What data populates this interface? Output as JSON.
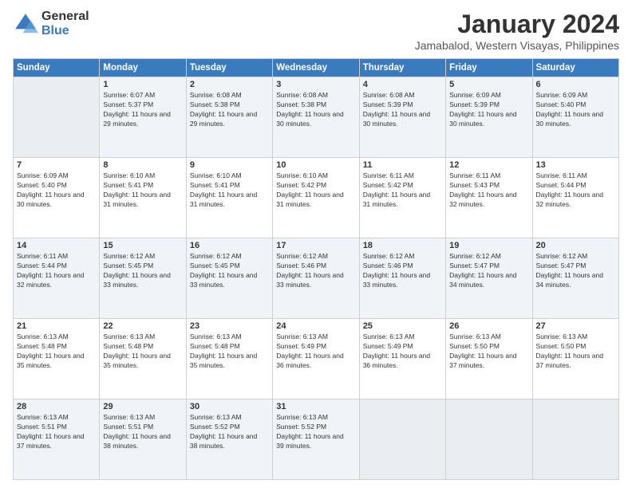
{
  "logo": {
    "general": "General",
    "blue": "Blue"
  },
  "header": {
    "month": "January 2024",
    "location": "Jamabalod, Western Visayas, Philippines"
  },
  "weekdays": [
    "Sunday",
    "Monday",
    "Tuesday",
    "Wednesday",
    "Thursday",
    "Friday",
    "Saturday"
  ],
  "weeks": [
    [
      {
        "day": "",
        "empty": true
      },
      {
        "day": "1",
        "sunrise": "6:07 AM",
        "sunset": "5:37 PM",
        "daylight": "11 hours and 29 minutes."
      },
      {
        "day": "2",
        "sunrise": "6:08 AM",
        "sunset": "5:38 PM",
        "daylight": "11 hours and 29 minutes."
      },
      {
        "day": "3",
        "sunrise": "6:08 AM",
        "sunset": "5:38 PM",
        "daylight": "11 hours and 30 minutes."
      },
      {
        "day": "4",
        "sunrise": "6:08 AM",
        "sunset": "5:39 PM",
        "daylight": "11 hours and 30 minutes."
      },
      {
        "day": "5",
        "sunrise": "6:09 AM",
        "sunset": "5:39 PM",
        "daylight": "11 hours and 30 minutes."
      },
      {
        "day": "6",
        "sunrise": "6:09 AM",
        "sunset": "5:40 PM",
        "daylight": "11 hours and 30 minutes."
      }
    ],
    [
      {
        "day": "7",
        "sunrise": "6:09 AM",
        "sunset": "5:40 PM",
        "daylight": "11 hours and 30 minutes."
      },
      {
        "day": "8",
        "sunrise": "6:10 AM",
        "sunset": "5:41 PM",
        "daylight": "11 hours and 31 minutes."
      },
      {
        "day": "9",
        "sunrise": "6:10 AM",
        "sunset": "5:41 PM",
        "daylight": "11 hours and 31 minutes."
      },
      {
        "day": "10",
        "sunrise": "6:10 AM",
        "sunset": "5:42 PM",
        "daylight": "11 hours and 31 minutes."
      },
      {
        "day": "11",
        "sunrise": "6:11 AM",
        "sunset": "5:42 PM",
        "daylight": "11 hours and 31 minutes."
      },
      {
        "day": "12",
        "sunrise": "6:11 AM",
        "sunset": "5:43 PM",
        "daylight": "11 hours and 32 minutes."
      },
      {
        "day": "13",
        "sunrise": "6:11 AM",
        "sunset": "5:44 PM",
        "daylight": "11 hours and 32 minutes."
      }
    ],
    [
      {
        "day": "14",
        "sunrise": "6:11 AM",
        "sunset": "5:44 PM",
        "daylight": "11 hours and 32 minutes."
      },
      {
        "day": "15",
        "sunrise": "6:12 AM",
        "sunset": "5:45 PM",
        "daylight": "11 hours and 33 minutes."
      },
      {
        "day": "16",
        "sunrise": "6:12 AM",
        "sunset": "5:45 PM",
        "daylight": "11 hours and 33 minutes."
      },
      {
        "day": "17",
        "sunrise": "6:12 AM",
        "sunset": "5:46 PM",
        "daylight": "11 hours and 33 minutes."
      },
      {
        "day": "18",
        "sunrise": "6:12 AM",
        "sunset": "5:46 PM",
        "daylight": "11 hours and 33 minutes."
      },
      {
        "day": "19",
        "sunrise": "6:12 AM",
        "sunset": "5:47 PM",
        "daylight": "11 hours and 34 minutes."
      },
      {
        "day": "20",
        "sunrise": "6:12 AM",
        "sunset": "5:47 PM",
        "daylight": "11 hours and 34 minutes."
      }
    ],
    [
      {
        "day": "21",
        "sunrise": "6:13 AM",
        "sunset": "5:48 PM",
        "daylight": "11 hours and 35 minutes."
      },
      {
        "day": "22",
        "sunrise": "6:13 AM",
        "sunset": "5:48 PM",
        "daylight": "11 hours and 35 minutes."
      },
      {
        "day": "23",
        "sunrise": "6:13 AM",
        "sunset": "5:48 PM",
        "daylight": "11 hours and 35 minutes."
      },
      {
        "day": "24",
        "sunrise": "6:13 AM",
        "sunset": "5:49 PM",
        "daylight": "11 hours and 36 minutes."
      },
      {
        "day": "25",
        "sunrise": "6:13 AM",
        "sunset": "5:49 PM",
        "daylight": "11 hours and 36 minutes."
      },
      {
        "day": "26",
        "sunrise": "6:13 AM",
        "sunset": "5:50 PM",
        "daylight": "11 hours and 37 minutes."
      },
      {
        "day": "27",
        "sunrise": "6:13 AM",
        "sunset": "5:50 PM",
        "daylight": "11 hours and 37 minutes."
      }
    ],
    [
      {
        "day": "28",
        "sunrise": "6:13 AM",
        "sunset": "5:51 PM",
        "daylight": "11 hours and 37 minutes."
      },
      {
        "day": "29",
        "sunrise": "6:13 AM",
        "sunset": "5:51 PM",
        "daylight": "11 hours and 38 minutes."
      },
      {
        "day": "30",
        "sunrise": "6:13 AM",
        "sunset": "5:52 PM",
        "daylight": "11 hours and 38 minutes."
      },
      {
        "day": "31",
        "sunrise": "6:13 AM",
        "sunset": "5:52 PM",
        "daylight": "11 hours and 39 minutes."
      },
      {
        "day": "",
        "empty": true
      },
      {
        "day": "",
        "empty": true
      },
      {
        "day": "",
        "empty": true
      }
    ]
  ]
}
